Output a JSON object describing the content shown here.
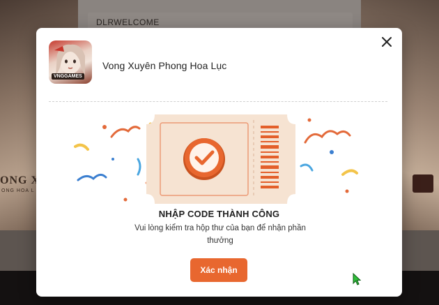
{
  "background": {
    "code_value": "DLRWELCOME",
    "brand_text": "ONG XUYÊ",
    "brand_sub": "ONG HOA L"
  },
  "modal": {
    "app_name": "Vong Xuyên Phong Hoa Lục",
    "app_icon_tag": "VNGGAMES",
    "success_title": "NHẬP CODE THÀNH CÔNG",
    "success_message": "Vui lòng kiểm tra hộp thư của bạn để nhận phần thưởng",
    "confirm_label": "Xác nhận",
    "close_icon": "close-icon"
  },
  "colors": {
    "accent": "#e8672f",
    "ticket": "#f6e3d2",
    "ticket_stripe": "#e35f2a"
  }
}
